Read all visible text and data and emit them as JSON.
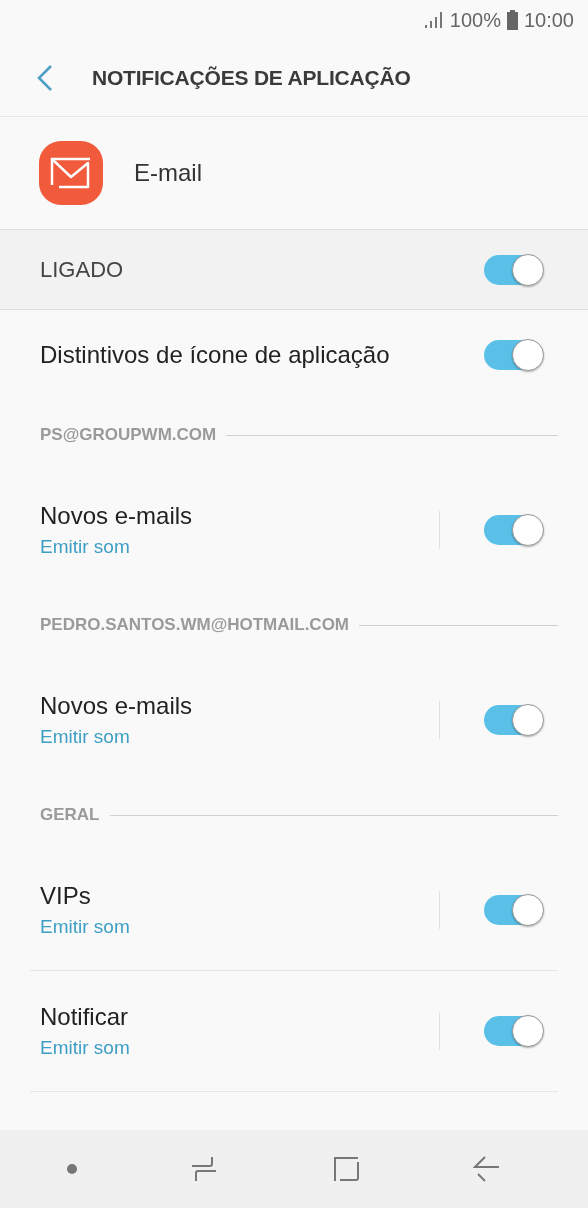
{
  "status_bar": {
    "battery": "100%",
    "time": "10:00"
  },
  "header": {
    "title": "NOTIFICAÇÕES DE APLICAÇÃO"
  },
  "app": {
    "name": "E-mail"
  },
  "master": {
    "label": "LIGADO",
    "on": true
  },
  "items": [
    {
      "kind": "toggle",
      "title": "Distintivos de ícone de aplicação",
      "on": true
    },
    {
      "kind": "section",
      "title": "PS@GROUPWM.COM"
    },
    {
      "kind": "toggle",
      "title": "Novos e-mails",
      "subtitle": "Emitir som",
      "on": true
    },
    {
      "kind": "section",
      "title": "PEDRO.SANTOS.WM@HOTMAIL.COM"
    },
    {
      "kind": "toggle",
      "title": "Novos e-mails",
      "subtitle": "Emitir som",
      "on": true
    },
    {
      "kind": "section",
      "title": "GERAL"
    },
    {
      "kind": "toggle",
      "title": "VIPs",
      "subtitle": "Emitir som",
      "on": true
    },
    {
      "kind": "toggle",
      "title": "Notificar",
      "subtitle": "Emitir som",
      "on": true
    }
  ]
}
